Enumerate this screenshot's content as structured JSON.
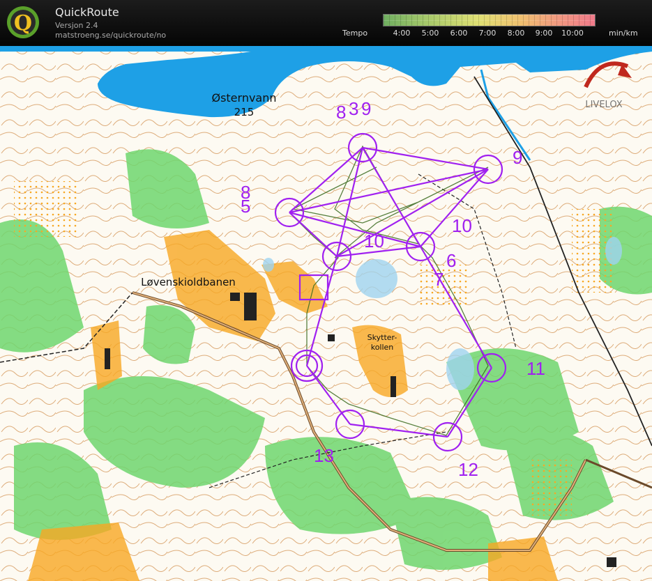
{
  "app": {
    "title": "QuickRoute",
    "version": "Versjon 2.4",
    "url": "matstroeng.se/quickroute/no",
    "logo_letter": "Q"
  },
  "tempo": {
    "label": "Tempo",
    "ticks": [
      "4:00",
      "5:00",
      "6:00",
      "7:00",
      "8:00",
      "9:00",
      "10:00"
    ],
    "unit": "min/km"
  },
  "map": {
    "lake_name": "Østernvann",
    "lake_height": "215",
    "area_label_1": "Løvenskioldbanen",
    "area_label_2_line1": "Skytter-",
    "area_label_2_line2": "kollen",
    "watermark": "LIVELOX",
    "control_labels": [
      "8",
      "3",
      "9",
      "9",
      "10",
      "10",
      "6",
      "5",
      "7",
      "8",
      "11",
      "12",
      "13"
    ],
    "colors": {
      "course": "#a020f0",
      "water": "#1ea0e6",
      "forest": "#4fc84f",
      "open": "#f7a823",
      "paper": "#ffffff"
    }
  }
}
